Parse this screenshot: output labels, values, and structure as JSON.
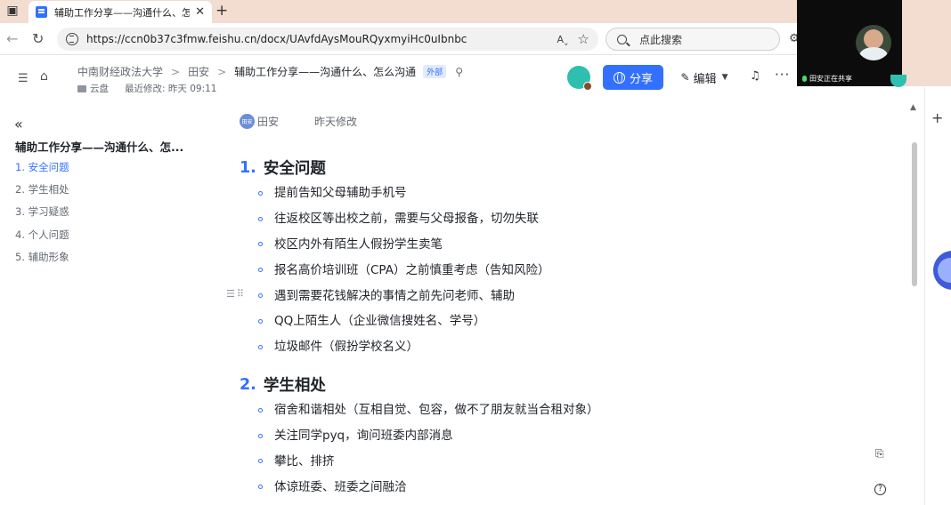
{
  "browser": {
    "tab_title": "辅助工作分享——沟通什么、怎么沟通",
    "url": "https://ccn0b37c3fmw.feishu.cn/docx/UAvfdAysMouRQyxmyiHc0uIbnbc",
    "search_placeholder": "点此搜索",
    "read_aloud_label": "Aˬ"
  },
  "doc_header": {
    "breadcrumbs": [
      "中南财经政法大学",
      "田安",
      "辅助工作分享——沟通什么、怎么沟通"
    ],
    "external_badge": "外部",
    "location": "云盘",
    "last_modified": "最近修改: 昨天 09:11",
    "share_label": "分享",
    "edit_label": "编辑"
  },
  "toc": {
    "title": "辅助工作分享——沟通什么、怎...",
    "items": [
      "1. 安全问题",
      "2. 学生相处",
      "3. 学习疑惑",
      "4. 个人问题",
      "5. 辅助形象"
    ],
    "active_index": 0
  },
  "doc": {
    "author": "田安",
    "author_avatar_text": "田安",
    "edited": "昨天修改",
    "sections": [
      {
        "number": "1.",
        "title": "安全问题",
        "bullets": [
          "提前告知父母辅助手机号",
          "往返校区等出校之前，需要与父母报备，切勿失联",
          "校区内外有陌生人假扮学生卖笔",
          "报名高价培训班（CPA）之前慎重考虑（告知风险）",
          "遇到需要花钱解决的事情之前先问老师、辅助",
          "QQ上陌生人（企业微信搜姓名、学号）",
          "垃圾邮件（假扮学校名义）"
        ]
      },
      {
        "number": "2.",
        "title": "学生相处",
        "bullets": [
          "宿舍和谐相处（互相自觉、包容，做不了朋友就当合租对象）",
          "关注同学pyq，询问班委内部消息",
          "攀比、排挤",
          "体谅班委、班委之间融洽"
        ]
      }
    ]
  },
  "webcam": {
    "label": "田安正在共享"
  },
  "colors": {
    "accent": "#3370ff",
    "tab_strip": "#f3dcd0",
    "text": "#1f2329",
    "muted": "#646a73"
  },
  "icons": [
    "window-icon",
    "doc-favicon-icon",
    "close-icon",
    "plus-icon",
    "back-icon",
    "reload-icon",
    "lock-icon",
    "read-aloud-icon",
    "star-icon",
    "search-icon",
    "toc-toggle-icon",
    "home-icon",
    "pin-icon",
    "folder-icon",
    "globe-icon",
    "pen-icon",
    "chevron-down-icon",
    "bell-icon",
    "more-icon",
    "collapse-icon",
    "drag-handle-icon",
    "help-icon"
  ]
}
